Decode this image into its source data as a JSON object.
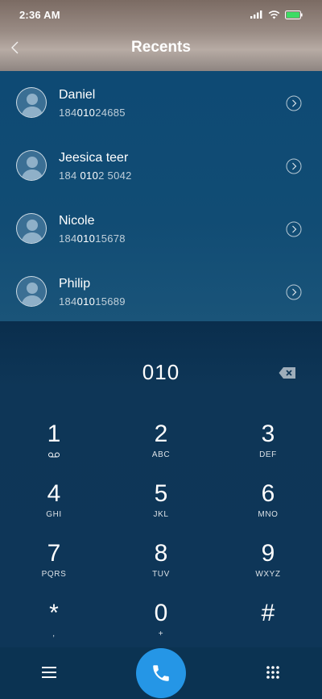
{
  "status": {
    "time": "2:36 AM"
  },
  "header": {
    "title": "Recents"
  },
  "recents": [
    {
      "name": "Daniel",
      "number_pre": "184",
      "number_match": "010",
      "number_post": "24685"
    },
    {
      "name": "Jeesica teer",
      "number_pre": "184 ",
      "number_match": "010",
      "number_post": "2 5042"
    },
    {
      "name": "Nicole",
      "number_pre": "184",
      "number_match": "010",
      "number_post": "15678"
    },
    {
      "name": "Philip",
      "number_pre": "184",
      "number_match": "010",
      "number_post": "15689"
    }
  ],
  "dialer": {
    "entry": "010"
  },
  "keys": [
    {
      "digit": "1",
      "letters": ""
    },
    {
      "digit": "2",
      "letters": "ABC"
    },
    {
      "digit": "3",
      "letters": "DEF"
    },
    {
      "digit": "4",
      "letters": "GHI"
    },
    {
      "digit": "5",
      "letters": "JKL"
    },
    {
      "digit": "6",
      "letters": "MNO"
    },
    {
      "digit": "7",
      "letters": "PQRS"
    },
    {
      "digit": "8",
      "letters": "TUV"
    },
    {
      "digit": "9",
      "letters": "WXYZ"
    },
    {
      "digit": "*",
      "letters": ","
    },
    {
      "digit": "0",
      "letters": "+"
    },
    {
      "digit": "#",
      "letters": ""
    }
  ],
  "colors": {
    "call": "#2596e6",
    "background": "#0f3d60"
  }
}
